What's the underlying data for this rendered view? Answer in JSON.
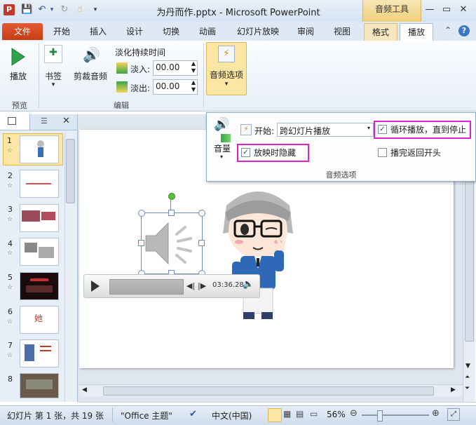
{
  "window": {
    "app_icon": "P",
    "title": "为丹而作.pptx - Microsoft PowerPoint",
    "context_header": "音频工具"
  },
  "tabs": {
    "file": "文件",
    "items": [
      "开始",
      "插入",
      "设计",
      "切换",
      "动画",
      "幻灯片放映",
      "审阅",
      "视图"
    ],
    "format": "格式",
    "playback": "播放"
  },
  "ribbon": {
    "play_label": "播放",
    "preview_group": "预览",
    "bookmark_label": "书签",
    "trim_label": "剪裁音频",
    "fade_title": "淡化持续时间",
    "fade_in_label": "淡入:",
    "fade_in_value": "00.00",
    "fade_out_label": "淡出:",
    "fade_out_value": "00.00",
    "edit_group": "编辑",
    "audio_options_label": "音频选项"
  },
  "audio_options": {
    "start_label": "开始:",
    "start_value": "跨幻灯片播放",
    "loop_label": "循环播放，直到停止",
    "loop_checked": true,
    "volume_label": "音量",
    "hide_label": "放映时隐藏",
    "hide_checked": true,
    "rewind_label": "播完返回开头",
    "rewind_checked": false,
    "group_label": "音频选项"
  },
  "slides": {
    "numbers": [
      "1",
      "2",
      "3",
      "4",
      "5",
      "6",
      "7",
      "8"
    ],
    "thumb6_text": "她"
  },
  "player": {
    "time": "03:36.28"
  },
  "status": {
    "slide_info": "幻灯片 第 1 张，共 19 张",
    "theme": "\"Office 主题\"",
    "language": "中文(中国)",
    "zoom": "56%"
  },
  "colors": {
    "file_tab": "#d24726",
    "highlight_box": "#e020c8",
    "context_tab": "#f1cf7a"
  }
}
